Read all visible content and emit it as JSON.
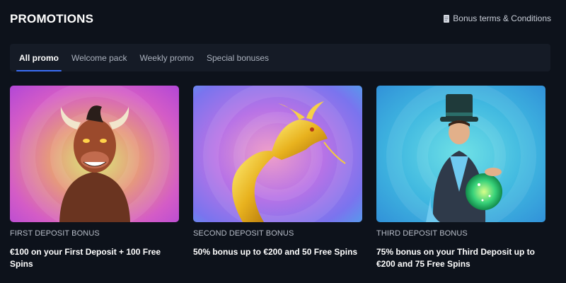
{
  "header": {
    "title": "PROMOTIONS",
    "terms_label": "Bonus terms & Conditions",
    "terms_icon": "document-icon"
  },
  "tabs": [
    {
      "label": "All promo",
      "active": true
    },
    {
      "label": "Welcome pack",
      "active": false
    },
    {
      "label": "Weekly promo",
      "active": false
    },
    {
      "label": "Special bonuses",
      "active": false
    }
  ],
  "promos": [
    {
      "category": "FIRST DEPOSIT BONUS",
      "title": "€100 on your First Deposit + 100 Free Spins",
      "image": "bull-character-image"
    },
    {
      "category": "SECOND DEPOSIT BONUS",
      "title": "50% bonus up to €200 and 50 Free Spins",
      "image": "golden-dragon-image"
    },
    {
      "category": "THIRD DEPOSIT BONUS",
      "title": "75% bonus on your Third Deposit up to €200 and 75 Free Spins",
      "image": "magician-character-image"
    }
  ],
  "colors": {
    "background": "#0d121b",
    "tab_bar": "#151b26",
    "accent": "#3b6ef5"
  }
}
